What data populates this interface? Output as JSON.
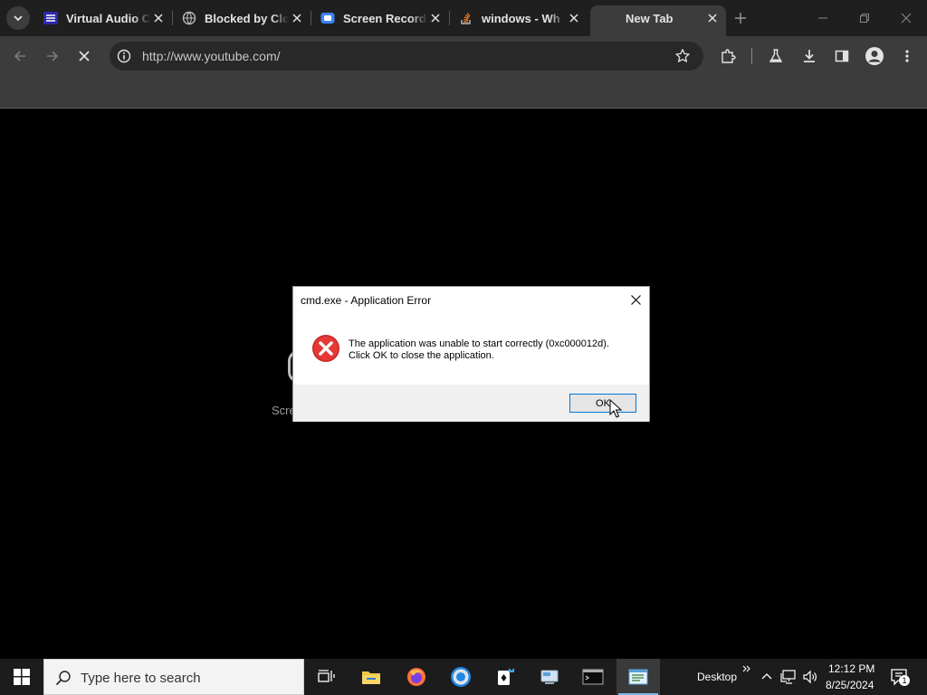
{
  "browser": {
    "tabs": [
      {
        "title": "Virtual Audio C",
        "favicon": "virtual-audio-favicon",
        "active": false
      },
      {
        "title": "Blocked by Clo",
        "favicon": "globe-favicon",
        "active": false
      },
      {
        "title": "Screen Record",
        "favicon": "screen-recorder-favicon",
        "active": false
      },
      {
        "title": "windows - Wh",
        "favicon": "stack-overflow-favicon",
        "active": false
      },
      {
        "title": "New Tab",
        "favicon": "",
        "active": true
      }
    ],
    "omnibox": {
      "url": "http://www.youtube.com/"
    }
  },
  "page": {
    "partial_text": "Scre"
  },
  "dialog": {
    "title": "cmd.exe - Application Error",
    "message_line1": "The application was unable to start correctly (0xc000012d).",
    "message_line2": "Click OK to close the application.",
    "ok_label": "OK"
  },
  "taskbar": {
    "search_placeholder": "Type here to search",
    "desktop_label": "Desktop",
    "time": "12:12 PM",
    "date": "8/25/2024",
    "notification_count": "1",
    "apps": [
      "task-view",
      "file-explorer",
      "firefox",
      "chrome",
      "solitaire",
      "control-panel",
      "terminal",
      "notepad"
    ]
  },
  "colors": {
    "tab_strip": "#1f1f1f",
    "toolbar": "#3c3c3c",
    "omnibox": "#282828",
    "error_red": "#d32f2f",
    "ok_border": "#0078d7",
    "taskbar": "#1c1c1c"
  }
}
